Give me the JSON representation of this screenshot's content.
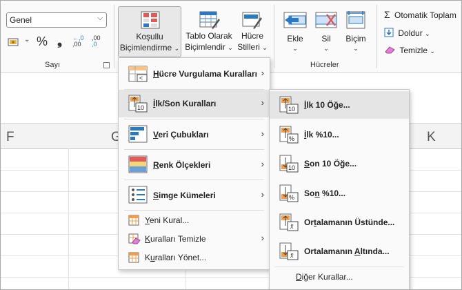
{
  "number_group": {
    "format_value": "Genel",
    "label": "Sayı",
    "percent_symbol": "%",
    "comma_symbol": "❟",
    "dec_increase": ",00",
    "dec_increase_top": "←,0",
    "dec_decrease": ",0",
    "dec_decrease_top": ",00"
  },
  "styles_group": {
    "conditional_formatting_line1": "Koşullu",
    "conditional_formatting_line2": "Biçimlendirme",
    "format_as_table_line1": "Tablo Olarak",
    "format_as_table_line2": "Biçimlendir",
    "cell_styles_line1": "Hücre",
    "cell_styles_line2": "Stilleri"
  },
  "cells_group": {
    "label": "Hücreler",
    "insert": "Ekle",
    "delete": "Sil",
    "format": "Biçim"
  },
  "editing_group": {
    "autosum": "Otomatik Toplam",
    "fill": "Doldur",
    "clear": "Temizle"
  },
  "columns": {
    "f": "F",
    "g": "G",
    "k": "K"
  },
  "cf_menu": {
    "items": [
      {
        "pre": "H",
        "rest": "ücre Vurgulama Kuralları"
      },
      {
        "pre": "İ",
        "rest": "lk/Son Kuralları"
      },
      {
        "pre": "V",
        "rest": "eri Çubukları"
      },
      {
        "pre": "R",
        "rest": "enk Ölçekleri"
      },
      {
        "pre": "S",
        "rest": "imge Kümeleri"
      }
    ],
    "new_rule_pre": "Y",
    "new_rule_rest": "eni Kural...",
    "clear_rules_pre": "K",
    "clear_rules_rest": "uralları Temizle",
    "manage_rules_pre": "K",
    "manage_rules_mid": "u",
    "manage_rules_rest": "ralları Yönet..."
  },
  "topbottom_menu": {
    "items": [
      {
        "pre": "İ",
        "rest": "lk 10 Öğe..."
      },
      {
        "pre": "İ",
        "rest": "lk %10..."
      },
      {
        "pre": "S",
        "rest": "on 10 Öğe..."
      },
      {
        "pre": "So",
        "u": "n",
        "rest": " %10..."
      },
      {
        "pre": "Or",
        "u": "t",
        "rest": "alamanın Üstünde..."
      },
      {
        "pre": "Ortalamanın ",
        "u": "A",
        "rest": "ltında..."
      }
    ],
    "more_rules_pre": "D",
    "more_rules_rest": "iğer Kurallar...",
    "icon_text": {
      "ten": "10",
      "percent": "%",
      "average": "x̄"
    }
  },
  "colors": {
    "accent_blue": "#2b79c2",
    "accent_orange": "#f39c4a",
    "accent_red": "#e05a5a",
    "menu_highlight": "#e5e5e5"
  }
}
